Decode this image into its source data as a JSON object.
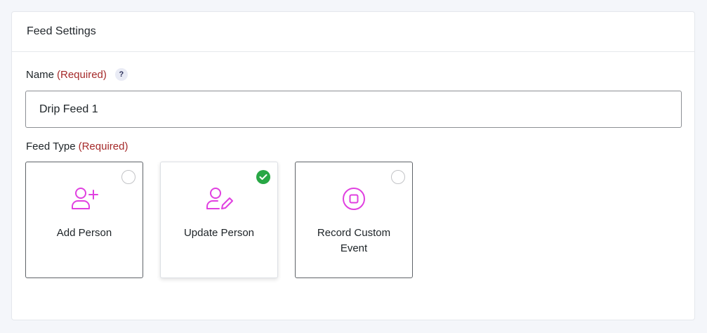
{
  "panel": {
    "title": "Feed Settings"
  },
  "name_field": {
    "label": "Name",
    "required": "(Required)",
    "help": "?",
    "value": "Drip Feed 1"
  },
  "feed_type": {
    "label": "Feed Type",
    "required": "(Required)",
    "options": [
      {
        "label": "Add Person",
        "icon": "add-person-icon",
        "selected": false
      },
      {
        "label": "Update Person",
        "icon": "edit-person-icon",
        "selected": true
      },
      {
        "label": "Record Custom Event",
        "icon": "record-event-icon",
        "selected": false
      }
    ]
  },
  "colors": {
    "accent": "#e040e0",
    "check": "#28a745",
    "required": "#a52a2a"
  }
}
